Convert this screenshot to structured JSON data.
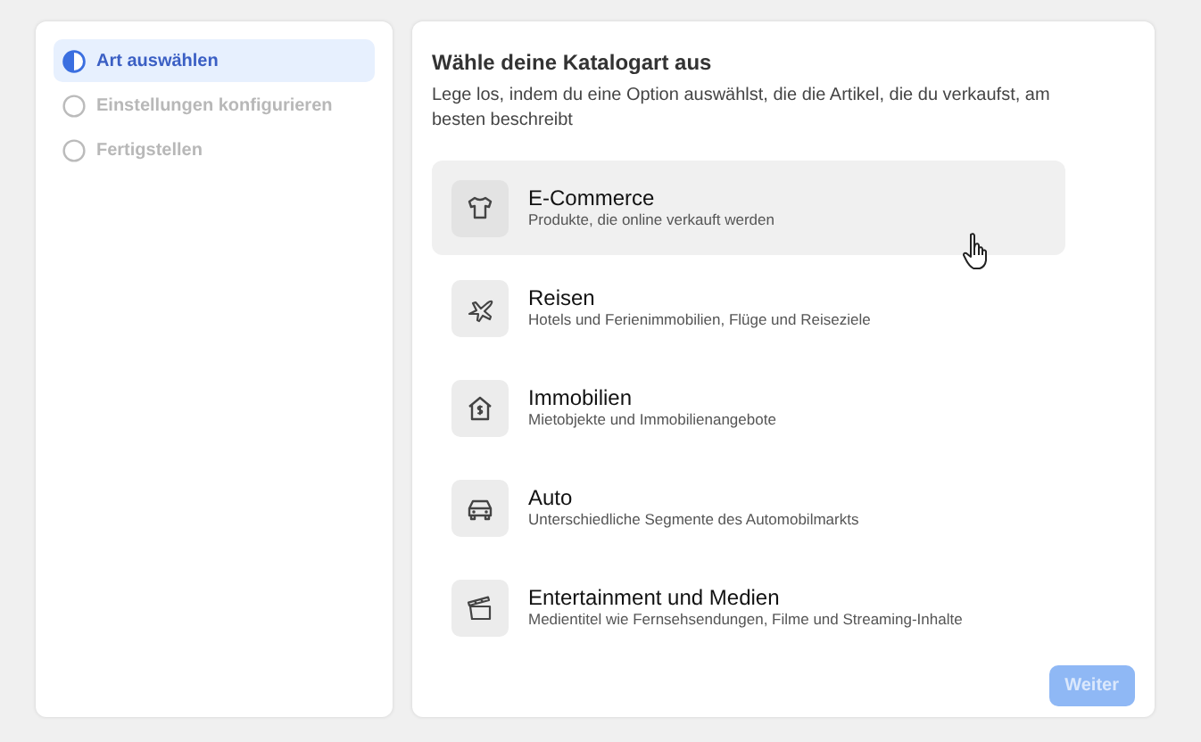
{
  "steps": [
    {
      "label": "Art auswählen",
      "selected": true
    },
    {
      "label": "Einstellungen konfigurieren",
      "selected": false
    },
    {
      "label": "Fertigstellen",
      "selected": false
    }
  ],
  "panel": {
    "title": "Wähle deine Katalogart aus",
    "subtitle": "Lege los, indem du eine Option auswählst, die die Artikel, die du verkaufst, am besten beschreibt"
  },
  "options": [
    {
      "kind": "shirt",
      "title": "E-Commerce",
      "description": "Produkte, die online verkauft werden",
      "hovered": true
    },
    {
      "kind": "plane",
      "title": "Reisen",
      "description": "Hotels und Ferienimmobilien, Flüge und Reiseziele",
      "hovered": false
    },
    {
      "kind": "house",
      "title": "Immobilien",
      "description": "Mietobjekte und Immobilienangebote",
      "hovered": false
    },
    {
      "kind": "car",
      "title": "Auto",
      "description": "Unterschiedliche Segmente des Automobilmarkts",
      "hovered": false
    },
    {
      "kind": "clapper",
      "title": "Entertainment und Medien",
      "description": "Medientitel wie Fernsehsendungen, Filme und Streaming-Inhalte",
      "hovered": false
    }
  ],
  "next_button": {
    "label": "Weiter",
    "disabled": true
  }
}
